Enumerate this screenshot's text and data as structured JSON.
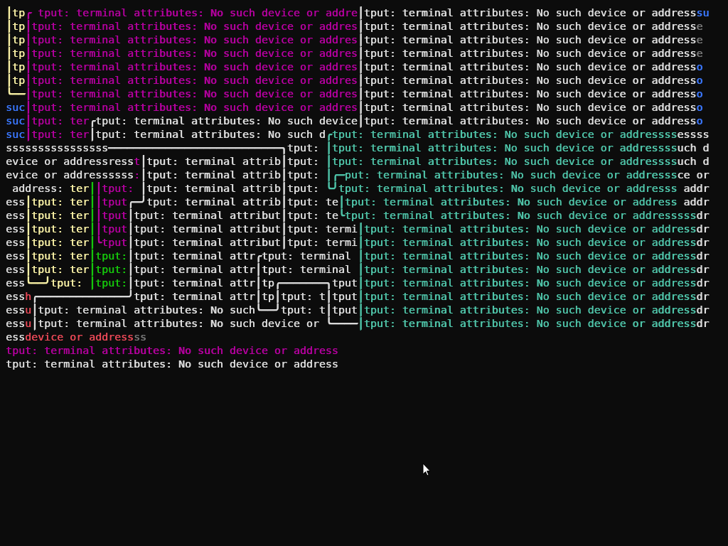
{
  "terminal": {
    "lines": [
      {
        "segments": [
          {
            "text": "│",
            "color": "#f9f1a5",
            "kind": "line"
          },
          {
            "text": "tp",
            "color": "#f9f1a5",
            "kind": "text"
          },
          {
            "text": "╭",
            "color": "#b4009e",
            "kind": "line"
          },
          {
            "text": " tput: terminal attributes: No such device or addre",
            "color": "#b4009e",
            "kind": "text"
          },
          {
            "text": "│",
            "color": "#dcdcdc",
            "kind": "line"
          },
          {
            "text": "tput: terminal attributes: No such device or address",
            "color": "#dcdcdc",
            "kind": "text"
          },
          {
            "text": "su",
            "color": "#3b78ff",
            "kind": "text"
          }
        ]
      },
      {
        "segments": [
          {
            "text": "│",
            "color": "#f9f1a5",
            "kind": "line"
          },
          {
            "text": "tp",
            "color": "#f9f1a5",
            "kind": "text"
          },
          {
            "text": "│",
            "color": "#b4009e",
            "kind": "line"
          },
          {
            "text": "tput: terminal attributes: No such device or addres",
            "color": "#b4009e",
            "kind": "text"
          },
          {
            "text": "│",
            "color": "#dcdcdc",
            "kind": "line"
          },
          {
            "text": "tput: terminal attributes: No such device or address",
            "color": "#dcdcdc",
            "kind": "text"
          },
          {
            "text": "e",
            "color": "#767676",
            "kind": "text"
          }
        ]
      },
      {
        "segments": [
          {
            "text": "│",
            "color": "#f9f1a5",
            "kind": "line"
          },
          {
            "text": "tp",
            "color": "#f9f1a5",
            "kind": "text"
          },
          {
            "text": "│",
            "color": "#b4009e",
            "kind": "line"
          },
          {
            "text": "tput: terminal attributes: No such device or addres",
            "color": "#b4009e",
            "kind": "text"
          },
          {
            "text": "│",
            "color": "#dcdcdc",
            "kind": "line"
          },
          {
            "text": "tput: terminal attributes: No such device or address",
            "color": "#dcdcdc",
            "kind": "text"
          },
          {
            "text": "e",
            "color": "#767676",
            "kind": "text"
          }
        ]
      },
      {
        "segments": [
          {
            "text": "│",
            "color": "#f9f1a5",
            "kind": "line"
          },
          {
            "text": "tp",
            "color": "#f9f1a5",
            "kind": "text"
          },
          {
            "text": "│",
            "color": "#b4009e",
            "kind": "line"
          },
          {
            "text": "tput: terminal attributes: No such device or addres",
            "color": "#b4009e",
            "kind": "text"
          },
          {
            "text": "│",
            "color": "#dcdcdc",
            "kind": "line"
          },
          {
            "text": "tput: terminal attributes: No such device or address",
            "color": "#dcdcdc",
            "kind": "text"
          },
          {
            "text": "e",
            "color": "#767676",
            "kind": "text"
          }
        ]
      },
      {
        "segments": [
          {
            "text": "│",
            "color": "#f9f1a5",
            "kind": "line"
          },
          {
            "text": "tp",
            "color": "#f9f1a5",
            "kind": "text"
          },
          {
            "text": "│",
            "color": "#b4009e",
            "kind": "line"
          },
          {
            "text": "tput: terminal attributes: No such device or addres",
            "color": "#b4009e",
            "kind": "text"
          },
          {
            "text": "│",
            "color": "#dcdcdc",
            "kind": "line"
          },
          {
            "text": "tput: terminal attributes: No such device or address",
            "color": "#dcdcdc",
            "kind": "text"
          },
          {
            "text": "o",
            "color": "#3b78ff",
            "kind": "text"
          }
        ]
      },
      {
        "segments": [
          {
            "text": "│",
            "color": "#f9f1a5",
            "kind": "line"
          },
          {
            "text": "tp",
            "color": "#f9f1a5",
            "kind": "text"
          },
          {
            "text": "│",
            "color": "#b4009e",
            "kind": "line"
          },
          {
            "text": "tput: terminal attributes: No such device or addres",
            "color": "#b4009e",
            "kind": "text"
          },
          {
            "text": "│",
            "color": "#dcdcdc",
            "kind": "line"
          },
          {
            "text": "tput: terminal attributes: No such device or address",
            "color": "#dcdcdc",
            "kind": "text"
          },
          {
            "text": "o",
            "color": "#3b78ff",
            "kind": "text"
          }
        ]
      },
      {
        "segments": [
          {
            "text": "╰──",
            "color": "#f9f1a5",
            "kind": "line"
          },
          {
            "text": "│",
            "color": "#b4009e",
            "kind": "line"
          },
          {
            "text": "tput: terminal attributes: No such device or addres",
            "color": "#b4009e",
            "kind": "text"
          },
          {
            "text": "│",
            "color": "#dcdcdc",
            "kind": "line"
          },
          {
            "text": "tput: terminal attributes: No such device or address",
            "color": "#dcdcdc",
            "kind": "text"
          },
          {
            "text": "o",
            "color": "#3b78ff",
            "kind": "text"
          }
        ]
      },
      {
        "segments": [
          {
            "text": "suc",
            "color": "#3b78ff",
            "kind": "text"
          },
          {
            "text": "│",
            "color": "#b4009e",
            "kind": "line"
          },
          {
            "text": "tput: terminal attributes: No such device or addres",
            "color": "#b4009e",
            "kind": "text"
          },
          {
            "text": "│",
            "color": "#dcdcdc",
            "kind": "line"
          },
          {
            "text": "tput: terminal attributes: No such device or address",
            "color": "#dcdcdc",
            "kind": "text"
          },
          {
            "text": "o",
            "color": "#3b78ff",
            "kind": "text"
          }
        ]
      },
      {
        "segments": [
          {
            "text": "suc",
            "color": "#3b78ff",
            "kind": "text"
          },
          {
            "text": "│",
            "color": "#b4009e",
            "kind": "line"
          },
          {
            "text": "tput: ter",
            "color": "#b4009e",
            "kind": "text"
          },
          {
            "text": "╭",
            "color": "#dcdcdc",
            "kind": "line"
          },
          {
            "text": "tput: terminal attributes: No such device",
            "color": "#dcdcdc",
            "kind": "text"
          },
          {
            "text": "│",
            "color": "#dcdcdc",
            "kind": "line"
          },
          {
            "text": "tput: terminal attributes: No such device or address",
            "color": "#dcdcdc",
            "kind": "text"
          },
          {
            "text": "o",
            "color": "#3b78ff",
            "kind": "text"
          }
        ]
      },
      {
        "segments": [
          {
            "text": "suc",
            "color": "#3b78ff",
            "kind": "text"
          },
          {
            "text": "│",
            "color": "#b4009e",
            "kind": "line"
          },
          {
            "text": "tput: ter",
            "color": "#b4009e",
            "kind": "text"
          },
          {
            "text": "│",
            "color": "#dcdcdc",
            "kind": "line"
          },
          {
            "text": "tput: terminal attributes: No such d",
            "color": "#dcdcdc",
            "kind": "text"
          },
          {
            "text": "╭",
            "color": "#4fc3a8",
            "kind": "line"
          },
          {
            "text": "tput: terminal attributes: No such device or addressss",
            "color": "#4fc3a8",
            "kind": "text"
          },
          {
            "text": "essss",
            "color": "#dcdcdc",
            "kind": "text"
          }
        ]
      },
      {
        "segments": [
          {
            "text": "ssssssssssssssss",
            "color": "#dcdcdc",
            "kind": "text"
          },
          {
            "text": "───────────────────────────╮",
            "color": "#dcdcdc",
            "kind": "line"
          },
          {
            "text": "tput: ",
            "color": "#dcdcdc",
            "kind": "text"
          },
          {
            "text": "│",
            "color": "#4fc3a8",
            "kind": "line"
          },
          {
            "text": "tput: terminal attributes: No such device or addressss",
            "color": "#4fc3a8",
            "kind": "text"
          },
          {
            "text": "uch d",
            "color": "#dcdcdc",
            "kind": "text"
          }
        ]
      },
      {
        "segments": [
          {
            "text": "evice or addressress",
            "color": "#dcdcdc",
            "kind": "text"
          },
          {
            "text": "t",
            "color": "#b4009e",
            "kind": "text"
          },
          {
            "text": "│",
            "color": "#dcdcdc",
            "kind": "line"
          },
          {
            "text": "tput: terminal attrib",
            "color": "#dcdcdc",
            "kind": "text"
          },
          {
            "text": "│",
            "color": "#dcdcdc",
            "kind": "line"
          },
          {
            "text": "tput: ",
            "color": "#dcdcdc",
            "kind": "text"
          },
          {
            "text": "│",
            "color": "#4fc3a8",
            "kind": "line"
          },
          {
            "text": "tput: terminal attributes: No such device or addressss",
            "color": "#4fc3a8",
            "kind": "text"
          },
          {
            "text": "uch d",
            "color": "#dcdcdc",
            "kind": "text"
          }
        ]
      },
      {
        "segments": [
          {
            "text": "evice or addressssss",
            "color": "#dcdcdc",
            "kind": "text"
          },
          {
            "text": ":",
            "color": "#b4009e",
            "kind": "text"
          },
          {
            "text": "│",
            "color": "#dcdcdc",
            "kind": "line"
          },
          {
            "text": "tput: terminal attrib",
            "color": "#dcdcdc",
            "kind": "text"
          },
          {
            "text": "│",
            "color": "#dcdcdc",
            "kind": "line"
          },
          {
            "text": "tput: ",
            "color": "#dcdcdc",
            "kind": "text"
          },
          {
            "text": "│╭─",
            "color": "#4fc3a8",
            "kind": "line"
          },
          {
            "text": "put: terminal attributes: No such device or addresss",
            "color": "#4fc3a8",
            "kind": "text"
          },
          {
            "text": "ce or",
            "color": "#dcdcdc",
            "kind": "text"
          }
        ]
      },
      {
        "segments": [
          {
            "text": " address: ",
            "color": "#dcdcdc",
            "kind": "text"
          },
          {
            "text": "ter",
            "color": "#f9f1a5",
            "kind": "text"
          },
          {
            "text": "│",
            "color": "#16c60c",
            "kind": "line"
          },
          {
            "text": "│",
            "color": "#b4009e",
            "kind": "line"
          },
          {
            "text": "tput: ",
            "color": "#b4009e",
            "kind": "text"
          },
          {
            "text": "│",
            "color": "#dcdcdc",
            "kind": "line"
          },
          {
            "text": "tput: terminal attrib",
            "color": "#dcdcdc",
            "kind": "text"
          },
          {
            "text": "│",
            "color": "#dcdcdc",
            "kind": "line"
          },
          {
            "text": "tput: ",
            "color": "#dcdcdc",
            "kind": "text"
          },
          {
            "text": "╰╯",
            "color": "#4fc3a8",
            "kind": "line"
          },
          {
            "text": "tput: terminal attributes: No such device or addresss",
            "color": "#4fc3a8",
            "kind": "text"
          },
          {
            "text": " addr",
            "color": "#dcdcdc",
            "kind": "text"
          }
        ]
      },
      {
        "segments": [
          {
            "text": "ess",
            "color": "#dcdcdc",
            "kind": "text"
          },
          {
            "text": "│",
            "color": "#f9f1a5",
            "kind": "line"
          },
          {
            "text": "tput: ter",
            "color": "#f9f1a5",
            "kind": "text"
          },
          {
            "text": "│",
            "color": "#16c60c",
            "kind": "line"
          },
          {
            "text": "│",
            "color": "#b4009e",
            "kind": "line"
          },
          {
            "text": "tput",
            "color": "#b4009e",
            "kind": "text"
          },
          {
            "text": "╭─╯",
            "color": "#dcdcdc",
            "kind": "line"
          },
          {
            "text": "tput: terminal attrib",
            "color": "#dcdcdc",
            "kind": "text"
          },
          {
            "text": "│",
            "color": "#dcdcdc",
            "kind": "line"
          },
          {
            "text": "tput: te",
            "color": "#dcdcdc",
            "kind": "text"
          },
          {
            "text": "│",
            "color": "#4fc3a8",
            "kind": "line"
          },
          {
            "text": "tput: terminal attributes: No such device or address",
            "color": "#4fc3a8",
            "kind": "text"
          },
          {
            "text": " addr",
            "color": "#dcdcdc",
            "kind": "text"
          }
        ]
      },
      {
        "segments": [
          {
            "text": "ess",
            "color": "#dcdcdc",
            "kind": "text"
          },
          {
            "text": "│",
            "color": "#f9f1a5",
            "kind": "line"
          },
          {
            "text": "tput: ter",
            "color": "#f9f1a5",
            "kind": "text"
          },
          {
            "text": "│",
            "color": "#16c60c",
            "kind": "line"
          },
          {
            "text": "│",
            "color": "#b4009e",
            "kind": "line"
          },
          {
            "text": "tput",
            "color": "#b4009e",
            "kind": "text"
          },
          {
            "text": "│",
            "color": "#dcdcdc",
            "kind": "line"
          },
          {
            "text": "tput: terminal attribut",
            "color": "#dcdcdc",
            "kind": "text"
          },
          {
            "text": "│",
            "color": "#dcdcdc",
            "kind": "line"
          },
          {
            "text": "tput: te",
            "color": "#dcdcdc",
            "kind": "text"
          },
          {
            "text": "╰",
            "color": "#4fc3a8",
            "kind": "line"
          },
          {
            "text": "tput: terminal attributes: No such device or addresssss",
            "color": "#4fc3a8",
            "kind": "text"
          },
          {
            "text": "dr",
            "color": "#dcdcdc",
            "kind": "text"
          }
        ]
      },
      {
        "segments": [
          {
            "text": "ess",
            "color": "#dcdcdc",
            "kind": "text"
          },
          {
            "text": "│",
            "color": "#f9f1a5",
            "kind": "line"
          },
          {
            "text": "tput: ter",
            "color": "#f9f1a5",
            "kind": "text"
          },
          {
            "text": "│",
            "color": "#16c60c",
            "kind": "line"
          },
          {
            "text": "│",
            "color": "#b4009e",
            "kind": "line"
          },
          {
            "text": "tput",
            "color": "#b4009e",
            "kind": "text"
          },
          {
            "text": "│",
            "color": "#dcdcdc",
            "kind": "line"
          },
          {
            "text": "tput: terminal attribut",
            "color": "#dcdcdc",
            "kind": "text"
          },
          {
            "text": "│",
            "color": "#dcdcdc",
            "kind": "line"
          },
          {
            "text": "tput: termi",
            "color": "#dcdcdc",
            "kind": "text"
          },
          {
            "text": "│",
            "color": "#4fc3a8",
            "kind": "line"
          },
          {
            "text": "tput: terminal attributes: No such device or address",
            "color": "#4fc3a8",
            "kind": "text"
          },
          {
            "text": "dr",
            "color": "#dcdcdc",
            "kind": "text"
          }
        ]
      },
      {
        "segments": [
          {
            "text": "ess",
            "color": "#dcdcdc",
            "kind": "text"
          },
          {
            "text": "│",
            "color": "#f9f1a5",
            "kind": "line"
          },
          {
            "text": "tput: ter",
            "color": "#f9f1a5",
            "kind": "text"
          },
          {
            "text": "│",
            "color": "#16c60c",
            "kind": "line"
          },
          {
            "text": "╰",
            "color": "#b4009e",
            "kind": "line"
          },
          {
            "text": "tput",
            "color": "#b4009e",
            "kind": "text"
          },
          {
            "text": "│",
            "color": "#dcdcdc",
            "kind": "line"
          },
          {
            "text": "tput: terminal attribut",
            "color": "#dcdcdc",
            "kind": "text"
          },
          {
            "text": "│",
            "color": "#dcdcdc",
            "kind": "line"
          },
          {
            "text": "tput: termi",
            "color": "#dcdcdc",
            "kind": "text"
          },
          {
            "text": "│",
            "color": "#4fc3a8",
            "kind": "line"
          },
          {
            "text": "tput: terminal attributes: No such device or address",
            "color": "#4fc3a8",
            "kind": "text"
          },
          {
            "text": "dr",
            "color": "#dcdcdc",
            "kind": "text"
          }
        ]
      },
      {
        "segments": [
          {
            "text": "ess",
            "color": "#dcdcdc",
            "kind": "text"
          },
          {
            "text": "│",
            "color": "#f9f1a5",
            "kind": "line"
          },
          {
            "text": "tput: ter",
            "color": "#f9f1a5",
            "kind": "text"
          },
          {
            "text": "│",
            "color": "#16c60c",
            "kind": "line"
          },
          {
            "text": "tput:",
            "color": "#16c60c",
            "kind": "text"
          },
          {
            "text": "│",
            "color": "#dcdcdc",
            "kind": "line"
          },
          {
            "text": "tput: terminal attr",
            "color": "#dcdcdc",
            "kind": "text"
          },
          {
            "text": "╭",
            "color": "#dcdcdc",
            "kind": "line"
          },
          {
            "text": "tput: terminal ",
            "color": "#dcdcdc",
            "kind": "text"
          },
          {
            "text": "│",
            "color": "#4fc3a8",
            "kind": "line"
          },
          {
            "text": "tput: terminal attributes: No such device or address",
            "color": "#4fc3a8",
            "kind": "text"
          },
          {
            "text": "dr",
            "color": "#dcdcdc",
            "kind": "text"
          }
        ]
      },
      {
        "segments": [
          {
            "text": "ess",
            "color": "#dcdcdc",
            "kind": "text"
          },
          {
            "text": "│",
            "color": "#f9f1a5",
            "kind": "line"
          },
          {
            "text": "tput: ter",
            "color": "#f9f1a5",
            "kind": "text"
          },
          {
            "text": "│",
            "color": "#16c60c",
            "kind": "line"
          },
          {
            "text": "tput:",
            "color": "#16c60c",
            "kind": "text"
          },
          {
            "text": "│",
            "color": "#dcdcdc",
            "kind": "line"
          },
          {
            "text": "tput: terminal attr",
            "color": "#dcdcdc",
            "kind": "text"
          },
          {
            "text": "│",
            "color": "#dcdcdc",
            "kind": "line"
          },
          {
            "text": "tput: terminal ",
            "color": "#dcdcdc",
            "kind": "text"
          },
          {
            "text": "│",
            "color": "#4fc3a8",
            "kind": "line"
          },
          {
            "text": "tput: terminal attributes: No such device or address",
            "color": "#4fc3a8",
            "kind": "text"
          },
          {
            "text": "dr",
            "color": "#dcdcdc",
            "kind": "text"
          }
        ]
      },
      {
        "segments": [
          {
            "text": "ess",
            "color": "#dcdcdc",
            "kind": "text"
          },
          {
            "text": "╰──╯",
            "color": "#f9f1a5",
            "kind": "line"
          },
          {
            "text": "tput: ",
            "color": "#f9f1a5",
            "kind": "text"
          },
          {
            "text": "│",
            "color": "#16c60c",
            "kind": "line"
          },
          {
            "text": "tput:",
            "color": "#16c60c",
            "kind": "text"
          },
          {
            "text": "│",
            "color": "#dcdcdc",
            "kind": "line"
          },
          {
            "text": "tput: terminal attr",
            "color": "#dcdcdc",
            "kind": "text"
          },
          {
            "text": "│",
            "color": "#dcdcdc",
            "kind": "line"
          },
          {
            "text": "tp",
            "color": "#dcdcdc",
            "kind": "text"
          },
          {
            "text": "╭───────╮",
            "color": "#dcdcdc",
            "kind": "line"
          },
          {
            "text": "tput",
            "color": "#dcdcdc",
            "kind": "text"
          },
          {
            "text": "│",
            "color": "#4fc3a8",
            "kind": "line"
          },
          {
            "text": "tput: terminal attributes: No such device or address",
            "color": "#4fc3a8",
            "kind": "text"
          },
          {
            "text": "dr",
            "color": "#dcdcdc",
            "kind": "text"
          }
        ]
      },
      {
        "segments": [
          {
            "text": "ess",
            "color": "#dcdcdc",
            "kind": "text"
          },
          {
            "text": "h",
            "color": "#e74856",
            "kind": "text"
          },
          {
            "text": "╭──────────────╯",
            "color": "#dcdcdc",
            "kind": "line"
          },
          {
            "text": "tput: terminal attr",
            "color": "#dcdcdc",
            "kind": "text"
          },
          {
            "text": "│",
            "color": "#dcdcdc",
            "kind": "line"
          },
          {
            "text": "tp",
            "color": "#dcdcdc",
            "kind": "text"
          },
          {
            "text": "│",
            "color": "#dcdcdc",
            "kind": "line"
          },
          {
            "text": "tput: t",
            "color": "#dcdcdc",
            "kind": "text"
          },
          {
            "text": "│",
            "color": "#dcdcdc",
            "kind": "line"
          },
          {
            "text": "tput",
            "color": "#dcdcdc",
            "kind": "text"
          },
          {
            "text": "│",
            "color": "#4fc3a8",
            "kind": "line"
          },
          {
            "text": "tput: terminal attributes: No such device or address",
            "color": "#4fc3a8",
            "kind": "text"
          },
          {
            "text": "dr",
            "color": "#dcdcdc",
            "kind": "text"
          }
        ]
      },
      {
        "segments": [
          {
            "text": "ess",
            "color": "#dcdcdc",
            "kind": "text"
          },
          {
            "text": "u",
            "color": "#e74856",
            "kind": "text"
          },
          {
            "text": "│",
            "color": "#dcdcdc",
            "kind": "line"
          },
          {
            "text": "tput: terminal attributes: No such",
            "color": "#dcdcdc",
            "kind": "text"
          },
          {
            "text": "╰──╯",
            "color": "#dcdcdc",
            "kind": "line"
          },
          {
            "text": "tput: t",
            "color": "#dcdcdc",
            "kind": "text"
          },
          {
            "text": "│",
            "color": "#dcdcdc",
            "kind": "line"
          },
          {
            "text": "tput",
            "color": "#dcdcdc",
            "kind": "text"
          },
          {
            "text": "│",
            "color": "#4fc3a8",
            "kind": "line"
          },
          {
            "text": "tput: terminal attributes: No such device or address",
            "color": "#4fc3a8",
            "kind": "text"
          },
          {
            "text": "dr",
            "color": "#dcdcdc",
            "kind": "text"
          }
        ]
      },
      {
        "segments": [
          {
            "text": "ess",
            "color": "#dcdcdc",
            "kind": "text"
          },
          {
            "text": "u",
            "color": "#e74856",
            "kind": "text"
          },
          {
            "text": "│",
            "color": "#dcdcdc",
            "kind": "line"
          },
          {
            "text": "tput: terminal attributes: No such device or ",
            "color": "#dcdcdc",
            "kind": "text"
          },
          {
            "text": "╰────",
            "color": "#dcdcdc",
            "kind": "line"
          },
          {
            "text": "│",
            "color": "#4fc3a8",
            "kind": "line"
          },
          {
            "text": "tput: terminal attributes: No such device or address",
            "color": "#4fc3a8",
            "kind": "text"
          },
          {
            "text": "dr",
            "color": "#dcdcdc",
            "kind": "text"
          }
        ]
      },
      {
        "segments": [
          {
            "text": "ess",
            "color": "#dcdcdc",
            "kind": "text"
          },
          {
            "text": "device or address",
            "color": "#e74856",
            "kind": "text"
          },
          {
            "text": "ss",
            "color": "#767676",
            "kind": "text"
          }
        ]
      },
      {
        "segments": [
          {
            "text": "tput: terminal attributes: No such device or address",
            "color": "#b4009e",
            "kind": "text"
          }
        ]
      },
      {
        "segments": [
          {
            "text": "tput: terminal attributes: No such device or address",
            "color": "#dcdcdc",
            "kind": "text"
          }
        ]
      }
    ]
  }
}
